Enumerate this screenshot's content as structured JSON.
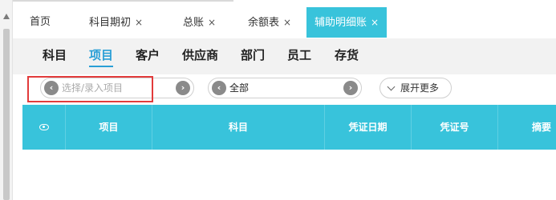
{
  "tabs": [
    {
      "label": "首页",
      "closable": false
    },
    {
      "label": "科目期初",
      "closable": true
    },
    {
      "label": "总账",
      "closable": true
    },
    {
      "label": "余额表",
      "closable": true
    },
    {
      "label": "辅助明细账",
      "closable": true,
      "active": true
    }
  ],
  "close_glyph": "×",
  "categories": [
    "科目",
    "项目",
    "客户",
    "供应商",
    "部门",
    "员工",
    "存货"
  ],
  "active_category": "项目",
  "filters": {
    "project": {
      "placeholder": "选择/录入项目",
      "value": ""
    },
    "scope": {
      "value": "全部"
    },
    "more_label": "展开更多"
  },
  "table": {
    "columns": [
      "项目",
      "科目",
      "凭证日期",
      "凭证号",
      "摘要"
    ],
    "settings_icon": "eye-icon",
    "rows": []
  },
  "colors": {
    "accent": "#38c3db",
    "active_category": "#2a9fd6",
    "highlight_box": "#e23b3b"
  }
}
